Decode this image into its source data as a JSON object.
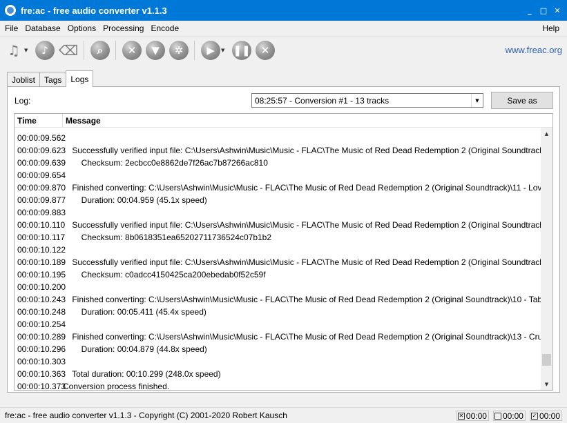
{
  "window": {
    "title": "fre:ac - free audio converter v1.1.3",
    "minimize": "_",
    "maximize": "□",
    "close": "✕"
  },
  "menu": {
    "file": "File",
    "database": "Database",
    "options": "Options",
    "processing": "Processing",
    "encode": "Encode",
    "help": "Help"
  },
  "toolbar": {
    "site_link": "www.freac.org",
    "icons": [
      "add-files-icon",
      "add-audio-cd-icon",
      "clear-joblist-icon",
      "search-cddb-icon",
      "configure-icon",
      "filter-icon",
      "settings-icon",
      "play-icon",
      "pause-icon",
      "stop-icon"
    ]
  },
  "tabs": {
    "joblist": "Joblist",
    "tags": "Tags",
    "logs": "Logs"
  },
  "logs": {
    "log_label": "Log:",
    "selected_log": "08:25:57 - Conversion #1 - 13 tracks",
    "save_as": "Save as",
    "columns": {
      "time": "Time",
      "message": "Message"
    },
    "rows": [
      {
        "time": "",
        "message": ""
      },
      {
        "time": "00:00:09.562",
        "message": ""
      },
      {
        "time": "00:00:09.623",
        "message": "    Successfully verified input file: C:\\Users\\Ashwin\\Music\\Music - FLAC\\The Music of Red Dead Redemption 2 (Original Soundtrack"
      },
      {
        "time": "00:00:09.639",
        "message": "        Checksum: 2ecbcc0e8862de7f26ac7b87266ac810"
      },
      {
        "time": "00:00:09.654",
        "message": ""
      },
      {
        "time": "00:00:09.870",
        "message": "    Finished converting: C:\\Users\\Ashwin\\Music\\Music - FLAC\\The Music of Red Dead Redemption 2 (Original Soundtrack)\\11 - Lov"
      },
      {
        "time": "00:00:09.877",
        "message": "        Duration: 00:04.959 (45.1x speed)"
      },
      {
        "time": "00:00:09.883",
        "message": ""
      },
      {
        "time": "00:00:10.110",
        "message": "    Successfully verified input file: C:\\Users\\Ashwin\\Music\\Music - FLAC\\The Music of Red Dead Redemption 2 (Original Soundtracl"
      },
      {
        "time": "00:00:10.117",
        "message": "        Checksum: 8b0618351ea65202711736524c07b1b2"
      },
      {
        "time": "00:00:10.122",
        "message": ""
      },
      {
        "time": "00:00:10.189",
        "message": "    Successfully verified input file: C:\\Users\\Ashwin\\Music\\Music - FLAC\\The Music of Red Dead Redemption 2 (Original Soundtracl"
      },
      {
        "time": "00:00:10.195",
        "message": "        Checksum: c0adcc4150425ca200ebedab0f52c59f"
      },
      {
        "time": "00:00:10.200",
        "message": ""
      },
      {
        "time": "00:00:10.243",
        "message": "    Finished converting: C:\\Users\\Ashwin\\Music\\Music - FLAC\\The Music of Red Dead Redemption 2 (Original Soundtrack)\\10 - Tab"
      },
      {
        "time": "00:00:10.248",
        "message": "        Duration: 00:05.411 (45.4x speed)"
      },
      {
        "time": "00:00:10.254",
        "message": ""
      },
      {
        "time": "00:00:10.289",
        "message": "    Finished converting: C:\\Users\\Ashwin\\Music\\Music - FLAC\\The Music of Red Dead Redemption 2 (Original Soundtrack)\\13 - Cru"
      },
      {
        "time": "00:00:10.296",
        "message": "        Duration: 00:04.879 (44.8x speed)"
      },
      {
        "time": "00:00:10.303",
        "message": ""
      },
      {
        "time": "00:00:10.363",
        "message": "    Total duration: 00:10.299 (248.0x speed)"
      },
      {
        "time": "00:00:10.373",
        "message": "Conversion process finished."
      }
    ]
  },
  "status": {
    "text": "fre:ac - free audio converter v1.1.3 - Copyright (C) 2001-2020 Robert Kausch",
    "indicators": [
      {
        "mark": "✕",
        "value": "00:00"
      },
      {
        "mark": "",
        "value": "00:00"
      },
      {
        "mark": "✓",
        "value": "00:00"
      }
    ]
  }
}
